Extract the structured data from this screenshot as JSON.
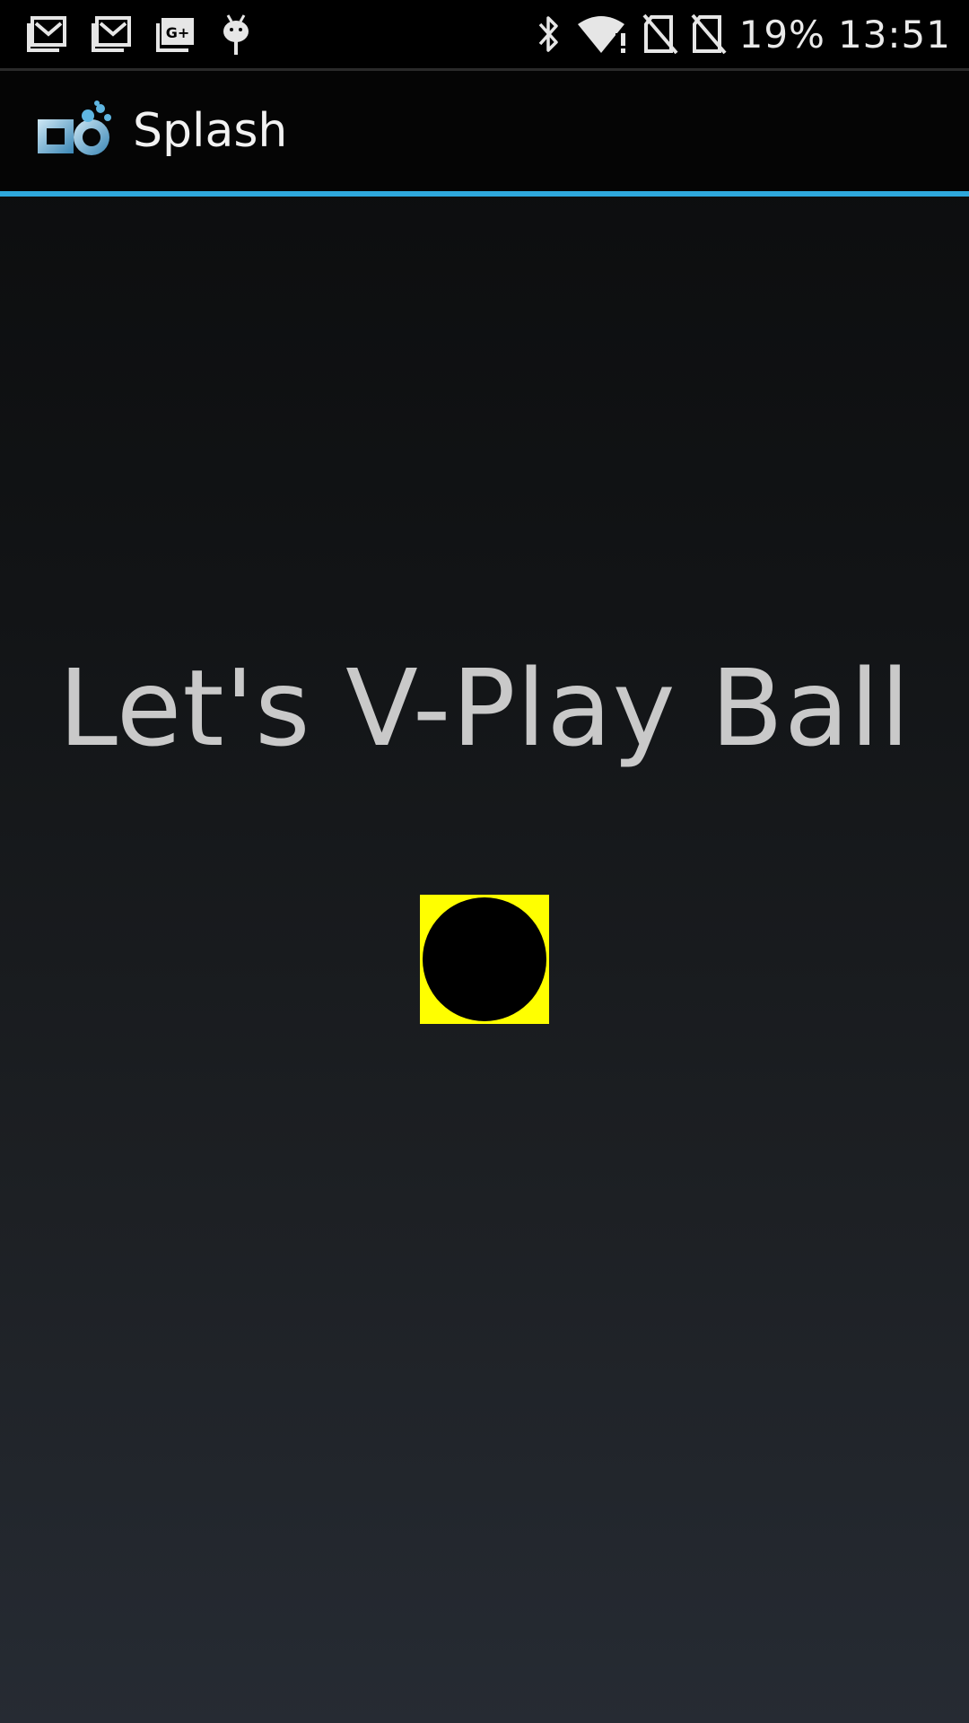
{
  "status_bar": {
    "left_icons": [
      "gmail-icon",
      "gmail-icon",
      "google-plus-icon",
      "android-debug-icon"
    ],
    "right_icons": [
      "bluetooth-icon",
      "wifi-alert-icon",
      "no-sim-icon",
      "no-sim-icon"
    ],
    "battery": "19%",
    "time": "13:51"
  },
  "app_bar": {
    "logo": "app-logo-icon",
    "title": "Splash",
    "accent_color": "#2ea8dc"
  },
  "main": {
    "headline": "Let's V-Play Ball",
    "ball_box_color": "#ffff00",
    "ball_color": "#000000"
  }
}
